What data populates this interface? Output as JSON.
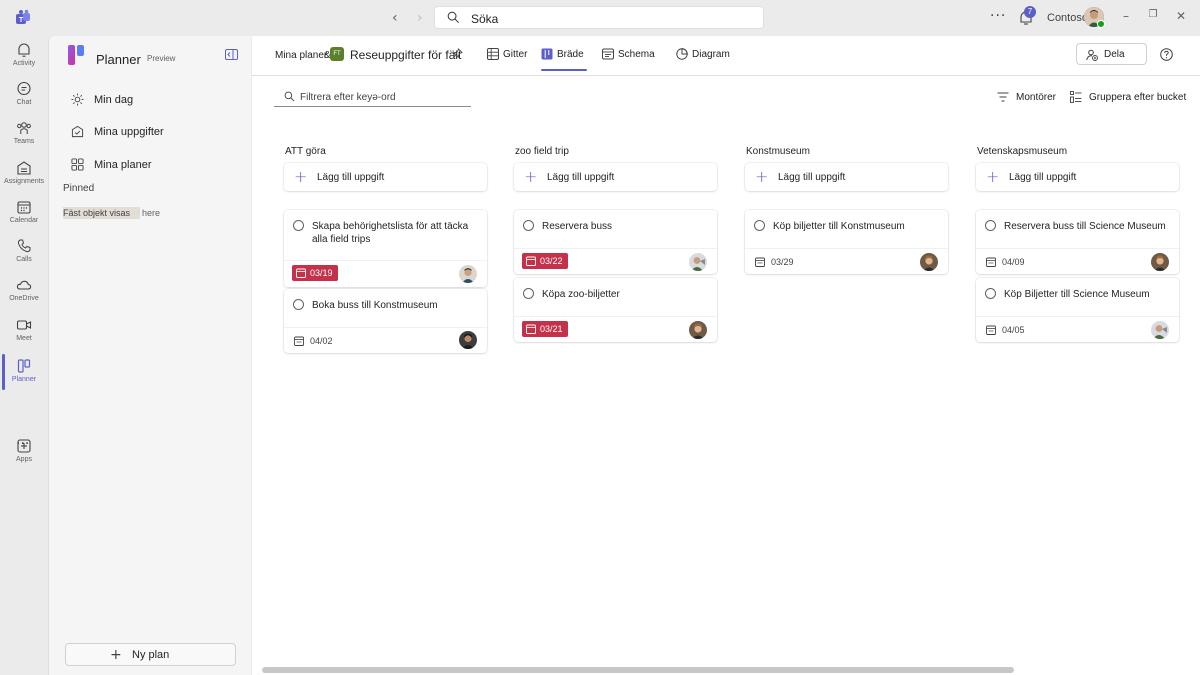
{
  "titlebar": {
    "search_placeholder": "Söka",
    "notification_count": "7",
    "org_name": "Contoso",
    "more": "···"
  },
  "rail": {
    "items": [
      {
        "label": "Activity",
        "icon": "bell-icon"
      },
      {
        "label": "Chat",
        "icon": "chat-icon"
      },
      {
        "label": "Teams",
        "icon": "teams-icon"
      },
      {
        "label": "Assignments",
        "icon": "assignments-icon"
      },
      {
        "label": "Calendar",
        "icon": "calendar-icon"
      },
      {
        "label": "Calls",
        "icon": "phone-icon"
      },
      {
        "label": "OneDrive",
        "icon": "cloud-icon"
      },
      {
        "label": "Meet",
        "icon": "video-icon"
      },
      {
        "label": "Planner",
        "icon": "planner-icon",
        "active": true
      },
      {
        "label": "Apps",
        "icon": "add-app-icon"
      }
    ],
    "more": "···"
  },
  "sidebar": {
    "app_name": "Planner",
    "badge": "Preview",
    "nav": [
      {
        "label": "Min dag",
        "icon": "sun-icon"
      },
      {
        "label": "Mina uppgifter",
        "icon": "tasks-icon"
      },
      {
        "label": "Mina planer",
        "icon": "grid-icon"
      }
    ],
    "pinned_label": "Pinned",
    "pinned_note": "Fäst objekt visas",
    "pinned_note_rest": "here",
    "new_plan": "Ny plan"
  },
  "header": {
    "breadcrumb_root": "Mina planer",
    "breadcrumb_sep": "&",
    "plan_badge": "FT",
    "plan_name": "Reseuppgifter för fält",
    "tabs": [
      {
        "label": "Gitter",
        "icon": "grid-view-icon"
      },
      {
        "label": "Bräde",
        "icon": "board-icon",
        "active": true
      },
      {
        "label": "Schema",
        "icon": "schedule-icon"
      },
      {
        "label": "Diagram",
        "icon": "chart-icon"
      }
    ],
    "share_label": "Dela"
  },
  "toolbar": {
    "filter_placeholder": "Filtrera efter keyə-ord",
    "filters_label": "Montörer",
    "group_label": "Gruppera efter bucket"
  },
  "colors": {
    "accent": "#5b5fc7",
    "late": "#c4314b",
    "plan_badge": "#5b7f2a"
  },
  "buckets": [
    {
      "title": "ATT göra",
      "add_label": "Lägg till uppgift",
      "cards": [
        {
          "title": "Skapa behörighetslista för att täcka alla field trips",
          "due": "03/19",
          "late": true
        },
        {
          "title": "Boka buss till Konstmuseum",
          "due": "04/02",
          "late": false
        }
      ]
    },
    {
      "title": "zoo field trip",
      "add_label": "Lägg till uppgift",
      "cards": [
        {
          "title": "Reservera buss",
          "due": "03/22",
          "late": true
        },
        {
          "title": "Köpa zoo-biljetter",
          "due": "03/21",
          "late": true
        }
      ]
    },
    {
      "title": "Konstmuseum",
      "add_label": "Lägg till uppgift",
      "cards": [
        {
          "title": "Köp biljetter till Konstmuseum",
          "due": "03/29",
          "late": false
        }
      ]
    },
    {
      "title": "Vetenskapsmuseum",
      "add_label": "Lägg till uppgift",
      "cards": [
        {
          "title": "Reservera buss till Science Museum",
          "due": "04/09",
          "late": false
        },
        {
          "title": "Köp Biljetter till Science Museum",
          "due": "04/05",
          "late": false
        }
      ]
    }
  ]
}
